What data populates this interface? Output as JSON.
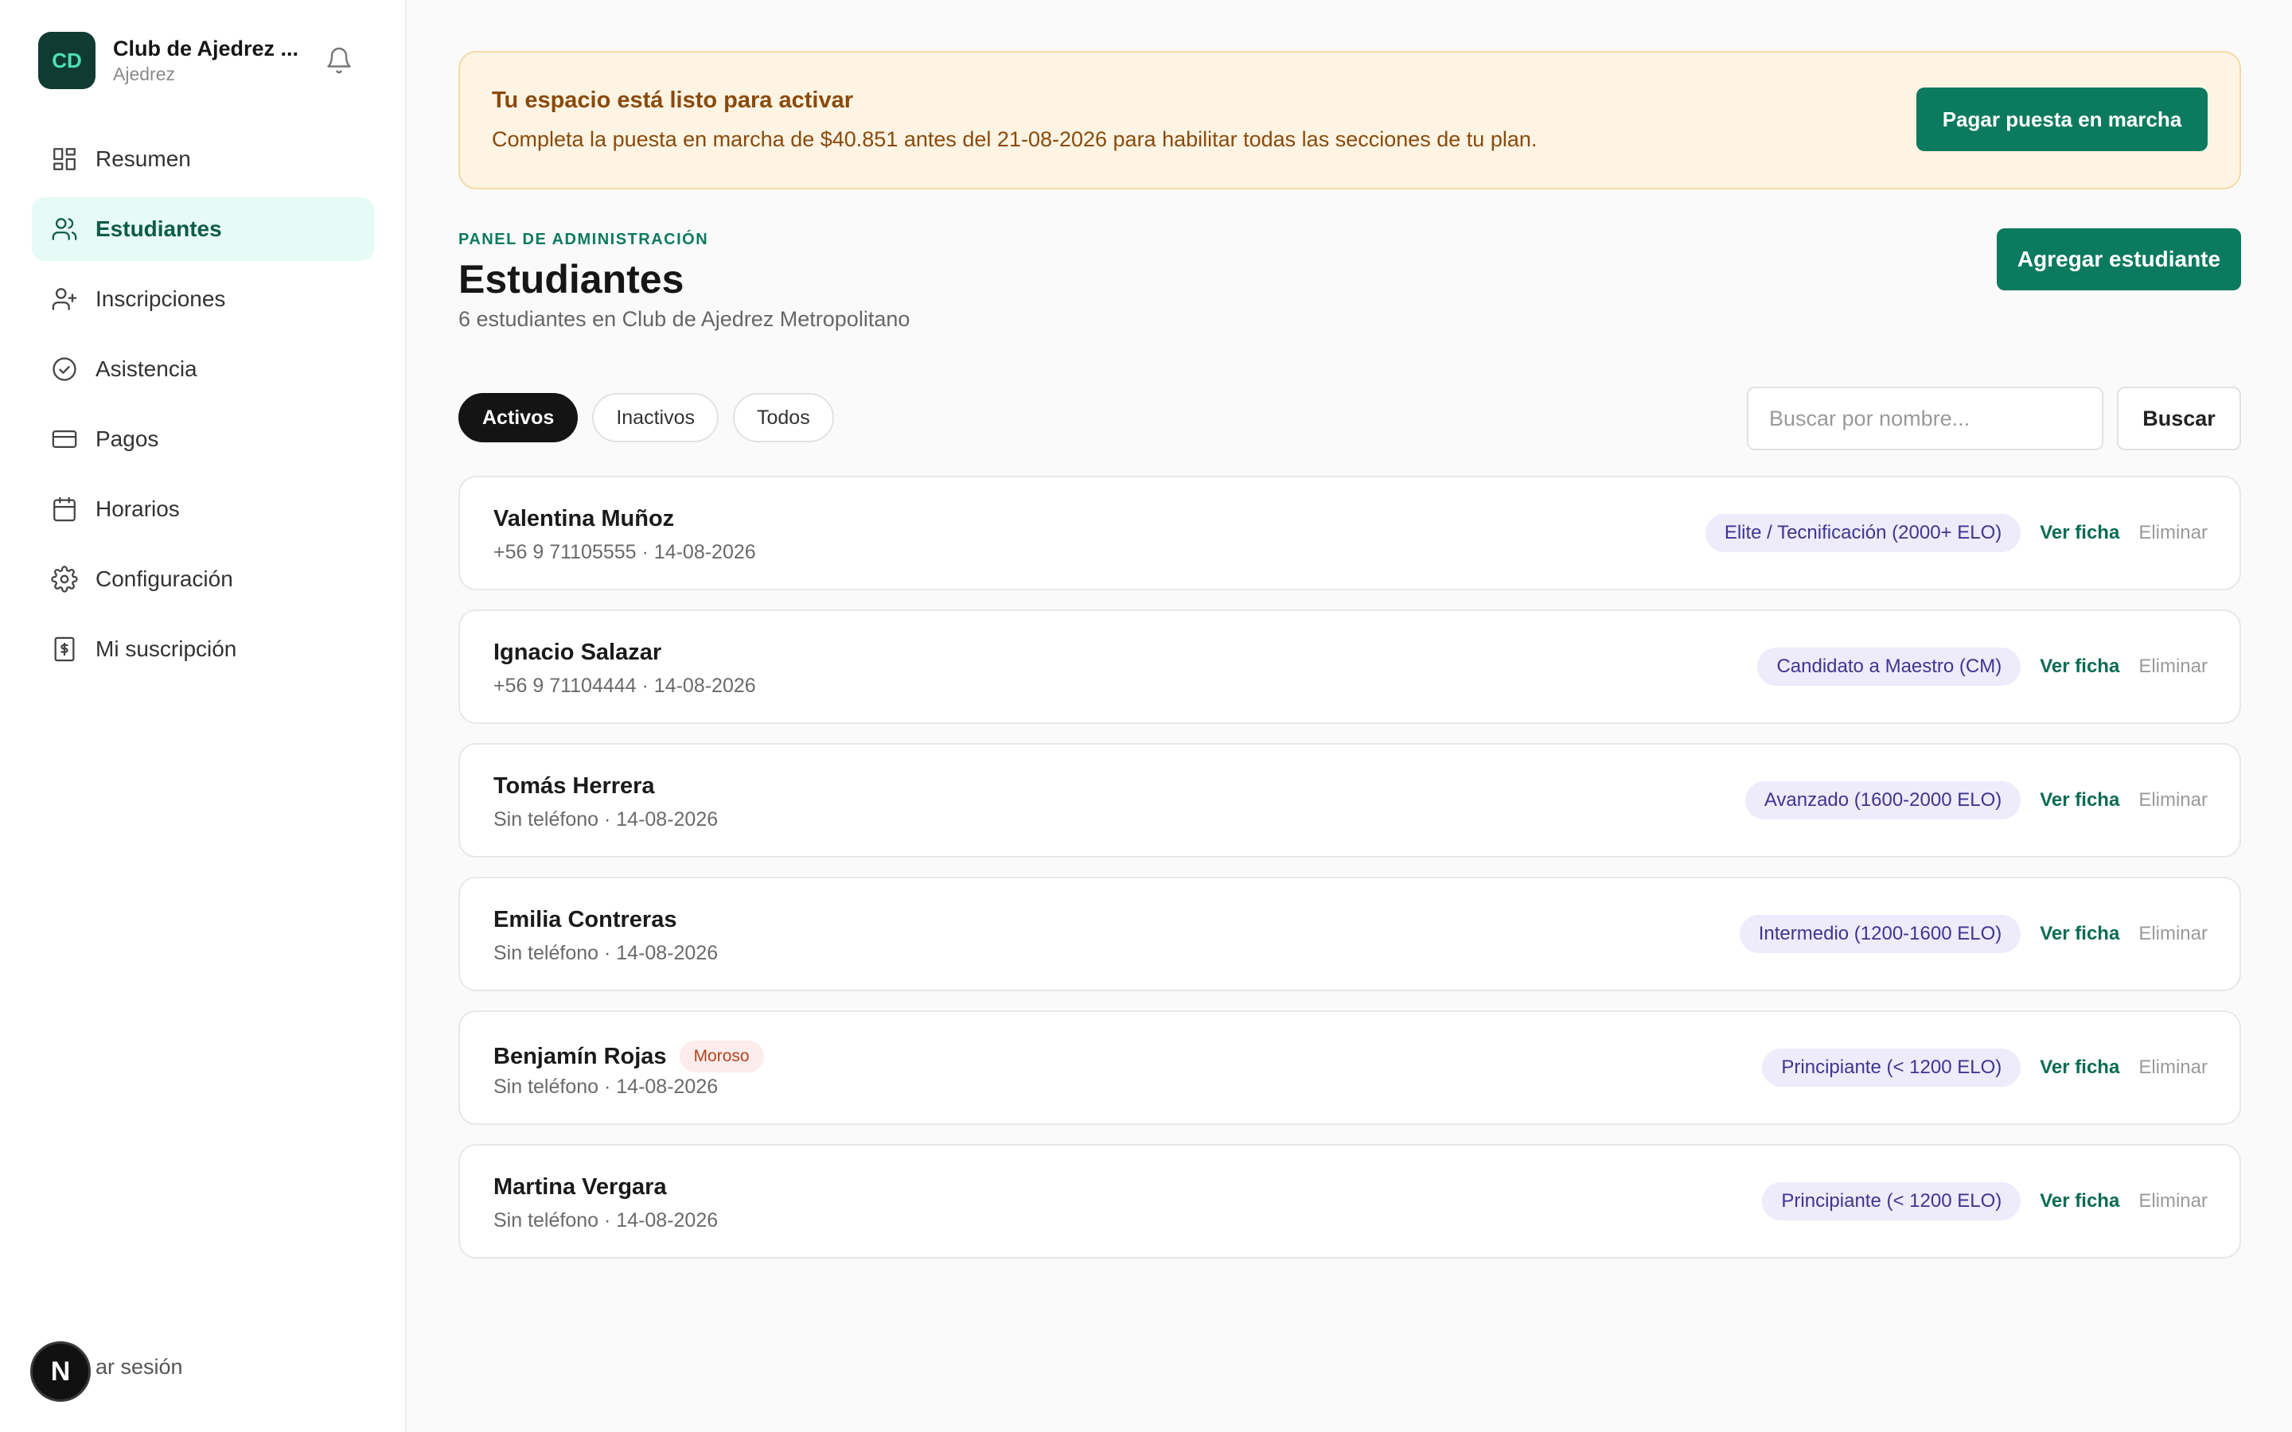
{
  "sidebar": {
    "logo_initials": "CD",
    "club_name": "Club de Ajedrez ...",
    "club_type": "Ajedrez",
    "notification_icon": "bell-icon",
    "items": [
      {
        "label": "Resumen",
        "icon": "dashboard-grid-icon",
        "active": false
      },
      {
        "label": "Estudiantes",
        "icon": "users-icon",
        "active": true
      },
      {
        "label": "Inscripciones",
        "icon": "user-plus-icon",
        "active": false
      },
      {
        "label": "Asistencia",
        "icon": "check-circle-icon",
        "active": false
      },
      {
        "label": "Pagos",
        "icon": "credit-card-icon",
        "active": false
      },
      {
        "label": "Horarios",
        "icon": "calendar-icon",
        "active": false
      },
      {
        "label": "Configuración",
        "icon": "gear-icon",
        "active": false
      },
      {
        "label": "Mi suscripción",
        "icon": "receipt-dollar-icon",
        "active": false
      }
    ],
    "logout_label": "ar sesión",
    "dev_badge_letter": "N"
  },
  "banner": {
    "title": "Tu espacio está listo para activar",
    "text": "Completa la puesta en marcha de $40.851 antes del 21-08-2026 para habilitar todas las secciones de tu plan.",
    "button_label": "Pagar puesta en marcha"
  },
  "header": {
    "eyebrow": "PANEL DE ADMINISTRACIÓN",
    "title": "Estudiantes",
    "subtitle": "6 estudiantes en Club de Ajedrez Metropolitano",
    "add_button_label": "Agregar estudiante"
  },
  "filters": {
    "tabs": [
      {
        "label": "Activos",
        "active": true
      },
      {
        "label": "Inactivos",
        "active": false
      },
      {
        "label": "Todos",
        "active": false
      }
    ],
    "search_placeholder": "Buscar por nombre...",
    "search_value": "",
    "search_button_label": "Buscar"
  },
  "students": [
    {
      "name": "Valentina Muñoz",
      "meta": "+56 9 71105555 · 14-08-2026",
      "level": "Elite / Tecnificación (2000+ ELO)",
      "badge": "",
      "view_label": "Ver ficha",
      "delete_label": "Eliminar"
    },
    {
      "name": "Ignacio Salazar",
      "meta": "+56 9 71104444 · 14-08-2026",
      "level": "Candidato a Maestro (CM)",
      "badge": "",
      "view_label": "Ver ficha",
      "delete_label": "Eliminar"
    },
    {
      "name": "Tomás Herrera",
      "meta": "Sin teléfono · 14-08-2026",
      "level": "Avanzado (1600-2000 ELO)",
      "badge": "",
      "view_label": "Ver ficha",
      "delete_label": "Eliminar"
    },
    {
      "name": "Emilia Contreras",
      "meta": "Sin teléfono · 14-08-2026",
      "level": "Intermedio (1200-1600 ELO)",
      "badge": "",
      "view_label": "Ver ficha",
      "delete_label": "Eliminar"
    },
    {
      "name": "Benjamín Rojas",
      "meta": "Sin teléfono · 14-08-2026",
      "level": "Principiante (< 1200 ELO)",
      "badge": "Moroso",
      "view_label": "Ver ficha",
      "delete_label": "Eliminar"
    },
    {
      "name": "Martina Vergara",
      "meta": "Sin teléfono · 14-08-2026",
      "level": "Principiante (< 1200 ELO)",
      "badge": "",
      "view_label": "Ver ficha",
      "delete_label": "Eliminar"
    }
  ],
  "colors": {
    "brand_green": "#0b7a5e",
    "active_nav_bg": "#e6fbf6",
    "banner_bg": "#fef4e3",
    "banner_text": "#8a4a0c",
    "level_badge_bg": "#eeebfb",
    "level_badge_text": "#3f3590",
    "moroso_bg": "#fdecec",
    "moroso_text": "#b0461e"
  }
}
